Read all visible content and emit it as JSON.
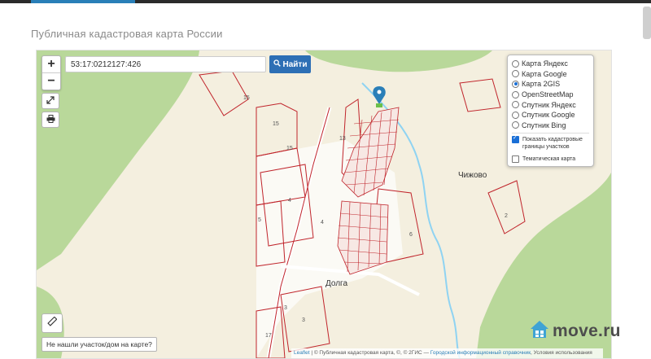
{
  "page": {
    "title": "Публичная кадастровая карта России"
  },
  "map": {
    "zoom_in": "+",
    "zoom_out": "−",
    "search_value": "53:17:0212127:426",
    "find_label": "Найти",
    "not_found_button": "Не нашли участок/дом на карте?",
    "places": [
      "Чижово",
      "Долга"
    ],
    "attribution": {
      "leaflet": "Leaflet",
      "text": " | © Публичная кадастровая карта, ©, © 2ГИС — ",
      "link": "Городской информационный справочник",
      "tail": ", Условия использования"
    }
  },
  "layers": {
    "options": [
      {
        "label": "Карта Яндекс",
        "selected": false
      },
      {
        "label": "Карта Google",
        "selected": false
      },
      {
        "label": "Карта 2GIS",
        "selected": true
      },
      {
        "label": "OpenStreetMap",
        "selected": false
      },
      {
        "label": "Спутник Яндекс",
        "selected": false
      },
      {
        "label": "Спутник Google",
        "selected": false
      },
      {
        "label": "Спутник Bing",
        "selected": false
      }
    ],
    "show_borders": {
      "label": "Показать кадастровые границы участков",
      "checked": true
    },
    "thematic": {
      "label": "Тематическая карта",
      "checked": false
    }
  },
  "parcel_numbers": [
    "15",
    "15",
    "15",
    "13",
    "4",
    "4",
    "5",
    "6",
    "2",
    "3",
    "17",
    "3"
  ],
  "watermark": {
    "text": "move.ru"
  },
  "colors": {
    "accent": "#2a7fb8",
    "button": "#2d6fb5",
    "parcel_line": "#c0242b",
    "forest": "#b9d89a",
    "river": "#8fd3f2",
    "land": "#f4efdf"
  },
  "icons": [
    "expand-icon",
    "print-icon",
    "ruler-icon",
    "search-icon",
    "map-marker-icon",
    "house-logo-icon"
  ]
}
